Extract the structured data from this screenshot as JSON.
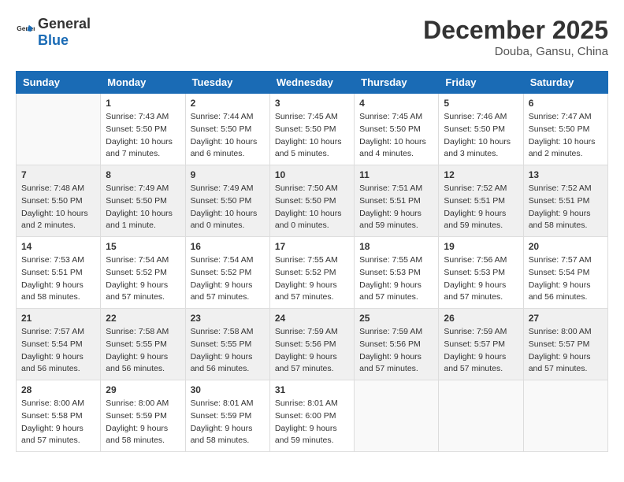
{
  "header": {
    "logo_general": "General",
    "logo_blue": "Blue",
    "month_year": "December 2025",
    "location": "Douba, Gansu, China"
  },
  "weekdays": [
    "Sunday",
    "Monday",
    "Tuesday",
    "Wednesday",
    "Thursday",
    "Friday",
    "Saturday"
  ],
  "weeks": [
    [
      {
        "day": "",
        "info": ""
      },
      {
        "day": "1",
        "info": "Sunrise: 7:43 AM\nSunset: 5:50 PM\nDaylight: 10 hours\nand 7 minutes."
      },
      {
        "day": "2",
        "info": "Sunrise: 7:44 AM\nSunset: 5:50 PM\nDaylight: 10 hours\nand 6 minutes."
      },
      {
        "day": "3",
        "info": "Sunrise: 7:45 AM\nSunset: 5:50 PM\nDaylight: 10 hours\nand 5 minutes."
      },
      {
        "day": "4",
        "info": "Sunrise: 7:45 AM\nSunset: 5:50 PM\nDaylight: 10 hours\nand 4 minutes."
      },
      {
        "day": "5",
        "info": "Sunrise: 7:46 AM\nSunset: 5:50 PM\nDaylight: 10 hours\nand 3 minutes."
      },
      {
        "day": "6",
        "info": "Sunrise: 7:47 AM\nSunset: 5:50 PM\nDaylight: 10 hours\nand 2 minutes."
      }
    ],
    [
      {
        "day": "7",
        "info": "Sunrise: 7:48 AM\nSunset: 5:50 PM\nDaylight: 10 hours\nand 2 minutes."
      },
      {
        "day": "8",
        "info": "Sunrise: 7:49 AM\nSunset: 5:50 PM\nDaylight: 10 hours\nand 1 minute."
      },
      {
        "day": "9",
        "info": "Sunrise: 7:49 AM\nSunset: 5:50 PM\nDaylight: 10 hours\nand 0 minutes."
      },
      {
        "day": "10",
        "info": "Sunrise: 7:50 AM\nSunset: 5:50 PM\nDaylight: 10 hours\nand 0 minutes."
      },
      {
        "day": "11",
        "info": "Sunrise: 7:51 AM\nSunset: 5:51 PM\nDaylight: 9 hours\nand 59 minutes."
      },
      {
        "day": "12",
        "info": "Sunrise: 7:52 AM\nSunset: 5:51 PM\nDaylight: 9 hours\nand 59 minutes."
      },
      {
        "day": "13",
        "info": "Sunrise: 7:52 AM\nSunset: 5:51 PM\nDaylight: 9 hours\nand 58 minutes."
      }
    ],
    [
      {
        "day": "14",
        "info": "Sunrise: 7:53 AM\nSunset: 5:51 PM\nDaylight: 9 hours\nand 58 minutes."
      },
      {
        "day": "15",
        "info": "Sunrise: 7:54 AM\nSunset: 5:52 PM\nDaylight: 9 hours\nand 57 minutes."
      },
      {
        "day": "16",
        "info": "Sunrise: 7:54 AM\nSunset: 5:52 PM\nDaylight: 9 hours\nand 57 minutes."
      },
      {
        "day": "17",
        "info": "Sunrise: 7:55 AM\nSunset: 5:52 PM\nDaylight: 9 hours\nand 57 minutes."
      },
      {
        "day": "18",
        "info": "Sunrise: 7:55 AM\nSunset: 5:53 PM\nDaylight: 9 hours\nand 57 minutes."
      },
      {
        "day": "19",
        "info": "Sunrise: 7:56 AM\nSunset: 5:53 PM\nDaylight: 9 hours\nand 57 minutes."
      },
      {
        "day": "20",
        "info": "Sunrise: 7:57 AM\nSunset: 5:54 PM\nDaylight: 9 hours\nand 56 minutes."
      }
    ],
    [
      {
        "day": "21",
        "info": "Sunrise: 7:57 AM\nSunset: 5:54 PM\nDaylight: 9 hours\nand 56 minutes."
      },
      {
        "day": "22",
        "info": "Sunrise: 7:58 AM\nSunset: 5:55 PM\nDaylight: 9 hours\nand 56 minutes."
      },
      {
        "day": "23",
        "info": "Sunrise: 7:58 AM\nSunset: 5:55 PM\nDaylight: 9 hours\nand 56 minutes."
      },
      {
        "day": "24",
        "info": "Sunrise: 7:59 AM\nSunset: 5:56 PM\nDaylight: 9 hours\nand 57 minutes."
      },
      {
        "day": "25",
        "info": "Sunrise: 7:59 AM\nSunset: 5:56 PM\nDaylight: 9 hours\nand 57 minutes."
      },
      {
        "day": "26",
        "info": "Sunrise: 7:59 AM\nSunset: 5:57 PM\nDaylight: 9 hours\nand 57 minutes."
      },
      {
        "day": "27",
        "info": "Sunrise: 8:00 AM\nSunset: 5:57 PM\nDaylight: 9 hours\nand 57 minutes."
      }
    ],
    [
      {
        "day": "28",
        "info": "Sunrise: 8:00 AM\nSunset: 5:58 PM\nDaylight: 9 hours\nand 57 minutes."
      },
      {
        "day": "29",
        "info": "Sunrise: 8:00 AM\nSunset: 5:59 PM\nDaylight: 9 hours\nand 58 minutes."
      },
      {
        "day": "30",
        "info": "Sunrise: 8:01 AM\nSunset: 5:59 PM\nDaylight: 9 hours\nand 58 minutes."
      },
      {
        "day": "31",
        "info": "Sunrise: 8:01 AM\nSunset: 6:00 PM\nDaylight: 9 hours\nand 59 minutes."
      },
      {
        "day": "",
        "info": ""
      },
      {
        "day": "",
        "info": ""
      },
      {
        "day": "",
        "info": ""
      }
    ]
  ]
}
